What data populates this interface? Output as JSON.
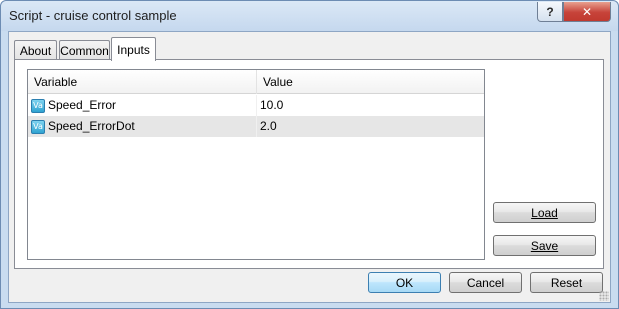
{
  "window": {
    "title": "Script - cruise control sample",
    "help_label": "?",
    "close_label": "✕",
    "frame_color": "#c9dcf0"
  },
  "tabs": [
    {
      "label": "About"
    },
    {
      "label": "Common"
    },
    {
      "label": "Inputs",
      "active": true
    }
  ],
  "table": {
    "columns": [
      "Variable",
      "Value"
    ],
    "rows": [
      {
        "icon": "variable-icon",
        "icon_text": "Va",
        "variable": "Speed_Error",
        "value": "10.0",
        "selected": false
      },
      {
        "icon": "variable-icon",
        "icon_text": "Va",
        "variable": "Speed_ErrorDot",
        "value": "2.0",
        "selected": true
      }
    ]
  },
  "side_buttons": {
    "load_label": "Load",
    "save_label": "Save"
  },
  "footer_buttons": {
    "ok_label": "OK",
    "cancel_label": "Cancel",
    "reset_label": "Reset"
  }
}
